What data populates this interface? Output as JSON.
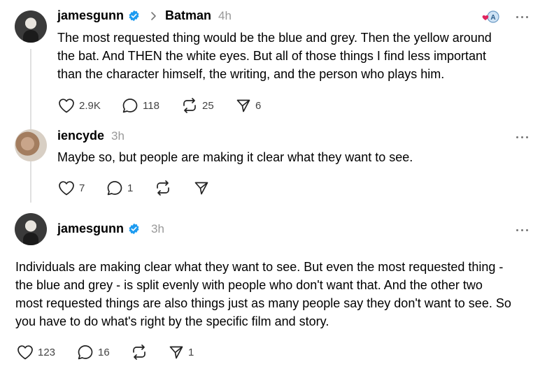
{
  "posts": [
    {
      "username": "jamesgunn",
      "verified": true,
      "topic": "Batman",
      "time": "4h",
      "text_lines": [
        "The most requested thing would be the blue and grey. Then the yellow around",
        "the bat. And THEN the white eyes. But all of those things I find less important",
        "than the character himself, the writing, and the person who plays him."
      ],
      "likes": "2.9K",
      "replies": "118",
      "reposts": "25",
      "shares": "6"
    },
    {
      "username": "iencyde",
      "time": "3h",
      "text_lines": [
        "Maybe so, but people are making it clear what they want to see."
      ],
      "likes": "7",
      "replies": "1"
    },
    {
      "username": "jamesgunn",
      "verified": true,
      "time": "3h",
      "text_lines": [
        "Individuals are making clear what they want to see. But even the most requested thing -",
        "the blue and grey - is split evenly with people who don't want that. And the other two",
        "most requested things are also things just as many people say they don't want to see. So",
        "you have to do what's right by the specific film and story."
      ],
      "likes": "123",
      "replies": "16",
      "shares": "1"
    }
  ],
  "colors": {
    "verified": "#1d9bf0",
    "muted": "#999999",
    "reaction_heart": "#e0245e"
  }
}
